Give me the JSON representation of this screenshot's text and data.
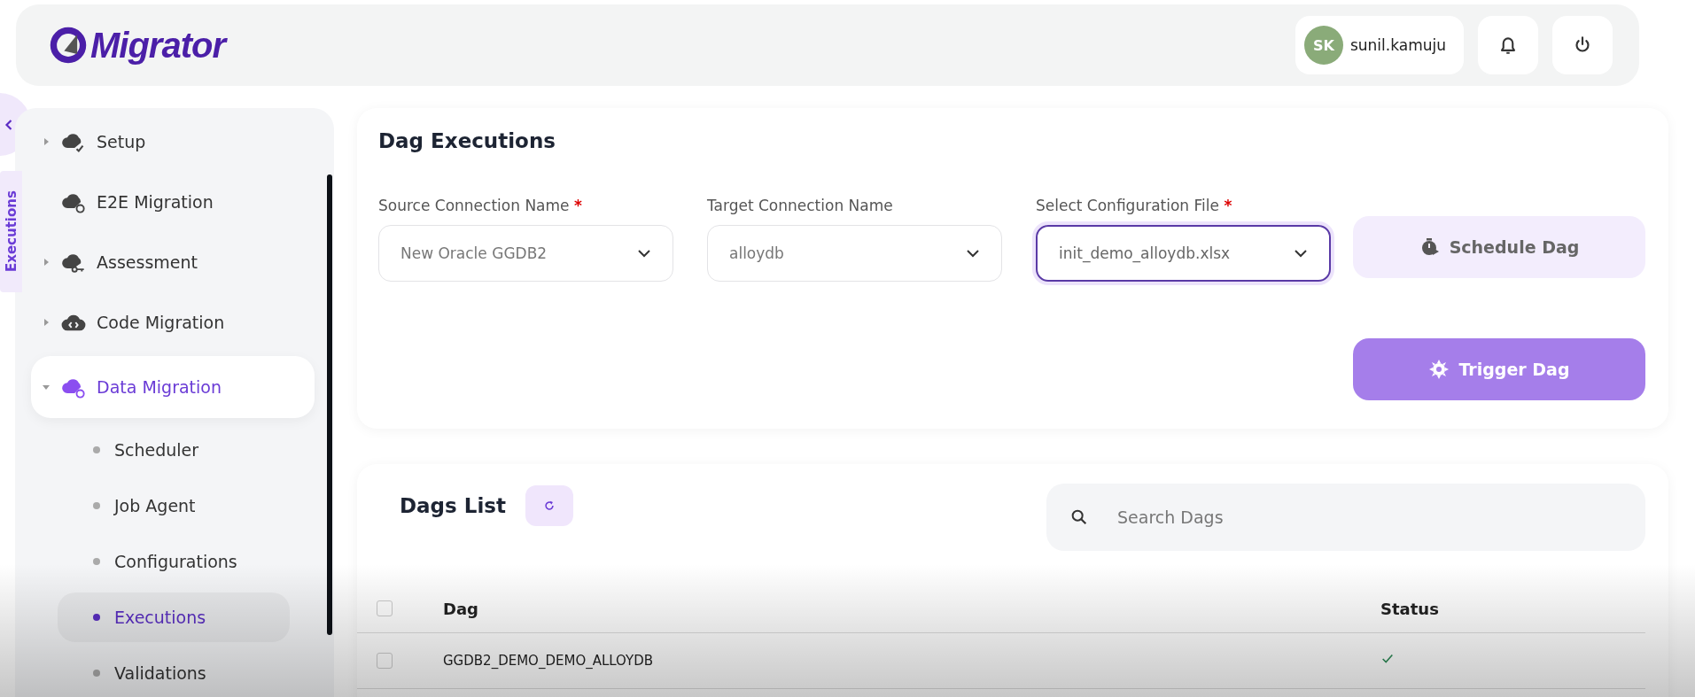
{
  "header": {
    "logo": "Migrator",
    "user": {
      "initials": "SK",
      "name": "sunil.kamuju"
    }
  },
  "side_tab": {
    "label": "Executions"
  },
  "sidebar": {
    "items": [
      {
        "label": "Setup",
        "kind": "check",
        "has_children": true,
        "expanded": false,
        "selected": false
      },
      {
        "label": "E2E Migration",
        "kind": "sync",
        "has_children": false,
        "selected": false
      },
      {
        "label": "Assessment",
        "kind": "key",
        "has_children": true,
        "expanded": false,
        "selected": false
      },
      {
        "label": "Code Migration",
        "kind": "code",
        "has_children": true,
        "expanded": false,
        "selected": false
      },
      {
        "label": "Data Migration",
        "kind": "sync",
        "has_children": true,
        "expanded": true,
        "selected": true,
        "children": [
          {
            "label": "Scheduler",
            "selected": false
          },
          {
            "label": "Job Agent",
            "selected": false
          },
          {
            "label": "Configurations",
            "selected": false
          },
          {
            "label": "Executions",
            "selected": true
          },
          {
            "label": "Validations",
            "selected": false
          }
        ]
      }
    ]
  },
  "executions": {
    "title": "Dag Executions",
    "fields": [
      {
        "label": "Source Connection Name",
        "required_mark": "*",
        "value": "New Oracle GGDB2",
        "focused": false
      },
      {
        "label": "Target Connection Name",
        "value": "alloydb",
        "focused": false
      },
      {
        "label": "Select Configuration File",
        "required_mark": "*",
        "value": "init_demo_alloydb.xlsx",
        "focused": true
      }
    ],
    "buttons": [
      {
        "label": "Schedule Dag",
        "kind": "timer",
        "disabled": true
      },
      {
        "label": "Trigger Dag",
        "kind": "gear",
        "disabled": false
      }
    ]
  },
  "dags": {
    "title": "Dags List",
    "search": {
      "placeholder": "Search Dags"
    },
    "select_all_checked": false,
    "columns": [
      "Dag",
      "Status"
    ],
    "rows": [
      {
        "dag": "GGDB2_DEMO_DEMO_ALLOYDB",
        "succeeded": true,
        "checked": false
      }
    ]
  }
}
